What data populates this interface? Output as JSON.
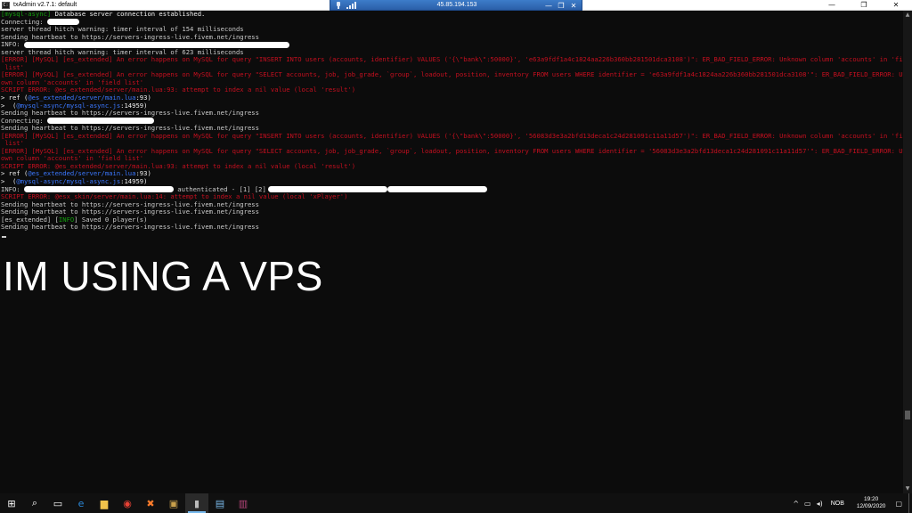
{
  "window": {
    "title": "txAdmin v2.7.1: default",
    "controls": [
      "—",
      "❐",
      "✕"
    ]
  },
  "remote_bar": {
    "ip": "45.85.194.153",
    "controls": [
      "—",
      "❐",
      "✕"
    ]
  },
  "console": {
    "lines": [
      {
        "parts": [
          {
            "t": "[mysql-async]",
            "c": "green"
          },
          {
            "t": " Database server connection established.",
            "c": "white"
          }
        ]
      },
      {
        "parts": [
          {
            "t": "Connecting: ",
            "c": ""
          }
        ],
        "redact": 36
      },
      {
        "parts": [
          {
            "t": "server thread hitch warning: timer interval of 154 milliseconds",
            "c": ""
          }
        ]
      },
      {
        "parts": [
          {
            "t": "Sending heartbeat to https://servers-ingress-live.fivem.net/ingress",
            "c": ""
          }
        ]
      },
      {
        "parts": [
          {
            "t": "INFO: ",
            "c": ""
          }
        ],
        "redact": 298
      },
      {
        "parts": [
          {
            "t": "server thread hitch warning: timer interval of 623 milliseconds",
            "c": ""
          }
        ]
      },
      {
        "parts": [
          {
            "t": "[ERROR] [MySQL] [es_extended] An error happens on MySQL for query \"INSERT INTO users (accounts, identifier) VALUES ('{\\\"bank\\\":50000}', 'e63a9fdf1a4c1824aa226b360bb281501dca3108')\": ER_BAD_FIELD_ERROR: Unknown column 'accounts' in 'field",
            "c": "red"
          }
        ]
      },
      {
        "parts": [
          {
            "t": " list'",
            "c": "red"
          }
        ]
      },
      {
        "parts": [
          {
            "t": "[ERROR] [MySQL] [es_extended] An error happens on MySQL for query \"SELECT accounts, job, job_grade, `group`, loadout, position, inventory FROM users WHERE identifier = 'e63a9fdf1a4c1824aa226b360bb281501dca3108'\": ER_BAD_FIELD_ERROR: Unkn",
            "c": "red"
          }
        ]
      },
      {
        "parts": [
          {
            "t": "own column 'accounts' in 'field list'",
            "c": "red"
          }
        ]
      },
      {
        "parts": [
          {
            "t": "SCRIPT ERROR: @es_extended/server/main.lua:93: attempt to index a nil value (local 'result')",
            "c": "red"
          }
        ]
      },
      {
        "parts": [
          {
            "t": "> ref (",
            "c": "white"
          },
          {
            "t": "@es_extended/server/main.lua",
            "c": "blue"
          },
          {
            "t": ":93)",
            "c": "white"
          }
        ]
      },
      {
        "parts": [
          {
            "t": ">  (",
            "c": "white"
          },
          {
            "t": "@mysql-async/mysql-async.js",
            "c": "blue"
          },
          {
            "t": ":14959)",
            "c": "white"
          }
        ]
      },
      {
        "parts": [
          {
            "t": "Sending heartbeat to https://servers-ingress-live.fivem.net/ingress",
            "c": ""
          }
        ]
      },
      {
        "parts": [
          {
            "t": "Connecting: ",
            "c": ""
          }
        ],
        "redact": 120
      },
      {
        "parts": [
          {
            "t": "Sending heartbeat to https://servers-ingress-live.fivem.net/ingress",
            "c": ""
          }
        ]
      },
      {
        "parts": [
          {
            "t": "[ERROR] [MySQL] [es_extended] An error happens on MySQL for query \"INSERT INTO users (accounts, identifier) VALUES ('{\\\"bank\\\":50000}', '56083d3e3a2bfd13deca1c24d281091c11a11d57')\": ER_BAD_FIELD_ERROR: Unknown column 'accounts' in 'field",
            "c": "red"
          }
        ]
      },
      {
        "parts": [
          {
            "t": " list'",
            "c": "red"
          }
        ]
      },
      {
        "parts": [
          {
            "t": "[ERROR] [MySQL] [es_extended] An error happens on MySQL for query \"SELECT accounts, job, job_grade, `group`, loadout, position, inventory FROM users WHERE identifier = '56083d3e3a2bfd13deca1c24d281091c11a11d57'\": ER_BAD_FIELD_ERROR: Unkn",
            "c": "red"
          }
        ]
      },
      {
        "parts": [
          {
            "t": "own column 'accounts' in 'field list'",
            "c": "red"
          }
        ]
      },
      {
        "parts": [
          {
            "t": "SCRIPT ERROR: @es_extended/server/main.lua:93: attempt to index a nil value (local 'result')",
            "c": "red"
          }
        ]
      },
      {
        "parts": [
          {
            "t": "> ref (",
            "c": "white"
          },
          {
            "t": "@es_extended/server/main.lua",
            "c": "blue"
          },
          {
            "t": ":93)",
            "c": "white"
          }
        ]
      },
      {
        "parts": [
          {
            "t": ">  (",
            "c": "white"
          },
          {
            "t": "@mysql-async/mysql-async.js",
            "c": "blue"
          },
          {
            "t": ":14959)",
            "c": "white"
          }
        ]
      },
      {
        "parts": [
          {
            "t": "INFO: ",
            "c": ""
          }
        ],
        "redact": 168,
        "after": " authenticated - [1] [2]",
        "redact2": 134,
        "redact3": 112
      },
      {
        "parts": [
          {
            "t": "SCRIPT ERROR: @esx_skin/server/main.lua:14: attempt to index a nil value (local 'xPlayer')",
            "c": "red"
          }
        ]
      },
      {
        "parts": [
          {
            "t": "Sending heartbeat to https://servers-ingress-live.fivem.net/ingress",
            "c": ""
          }
        ]
      },
      {
        "parts": [
          {
            "t": "Sending heartbeat to https://servers-ingress-live.fivem.net/ingress",
            "c": ""
          }
        ]
      },
      {
        "parts": [
          {
            "t": "[es_extended] [",
            "c": ""
          },
          {
            "t": "INFO",
            "c": "green"
          },
          {
            "t": "] Saved 0 player(s)",
            "c": ""
          }
        ]
      },
      {
        "parts": [
          {
            "t": "Sending heartbeat to https://servers-ingress-live.fivem.net/ingress",
            "c": ""
          }
        ]
      }
    ],
    "overlay_text": "IM USING A VPS"
  },
  "taskbar": {
    "icons": [
      {
        "name": "start-icon",
        "glyph": "⊞",
        "color": "#ffffff"
      },
      {
        "name": "search-icon",
        "glyph": "⌕",
        "color": "#ffffff"
      },
      {
        "name": "task-view-icon",
        "glyph": "▭",
        "color": "#ffffff"
      },
      {
        "name": "edge-icon",
        "glyph": "e",
        "color": "#2b88d8"
      },
      {
        "name": "file-explorer-icon",
        "glyph": "▆",
        "color": "#f0c24b"
      },
      {
        "name": "chrome-icon",
        "glyph": "◉",
        "color": "#e94235"
      },
      {
        "name": "xampp-icon",
        "glyph": "✖",
        "color": "#f97b2b"
      },
      {
        "name": "server-icon",
        "glyph": "▣",
        "color": "#c9a04b"
      },
      {
        "name": "cmd-icon",
        "glyph": "▮",
        "color": "#bbbbbb",
        "active": true
      },
      {
        "name": "notepad-icon",
        "glyph": "▤",
        "color": "#79b8e8"
      },
      {
        "name": "winrar-icon",
        "glyph": "▥",
        "color": "#b6457a"
      }
    ],
    "lang": "NOB",
    "time": "19:20",
    "date": "12/09/2020"
  }
}
